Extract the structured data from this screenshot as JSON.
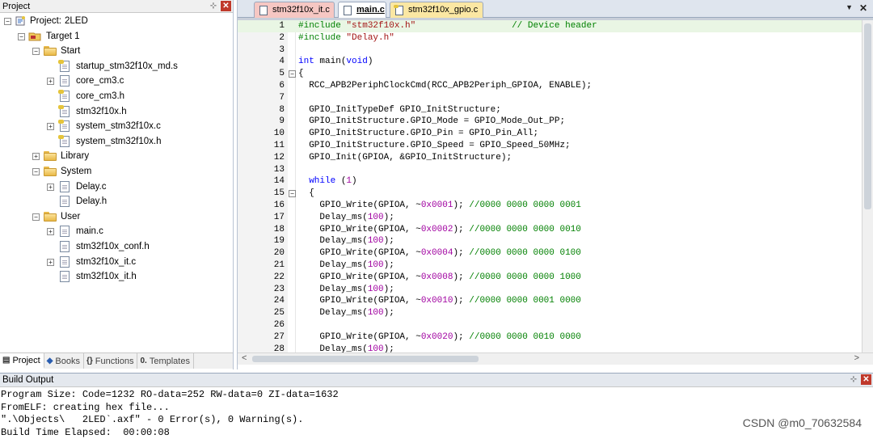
{
  "project_panel": {
    "title": "Project",
    "pin": "⊹",
    "close": "✕",
    "tree": {
      "project_label": "Project:",
      "project_name": "2LED",
      "target": "Target 1",
      "groups": [
        {
          "name": "Start",
          "files": [
            "startup_stm32f10x_md.s",
            "core_cm3.c",
            "core_cm3.h",
            "stm32f10x.h",
            "system_stm32f10x.c",
            "system_stm32f10x.h"
          ]
        },
        {
          "name": "Library",
          "files": []
        },
        {
          "name": "System",
          "files": [
            "Delay.c",
            "Delay.h"
          ]
        },
        {
          "name": "User",
          "files": [
            "main.c",
            "stm32f10x_conf.h",
            "stm32f10x_it.c",
            "stm32f10x_it.h"
          ]
        }
      ]
    },
    "tabs": [
      "Project",
      "Books",
      "Functions",
      "Templates"
    ]
  },
  "editor": {
    "tabs": [
      "stm32f10x_it.c",
      "main.c",
      "stm32f10x_gpio.c"
    ],
    "active_tab": "main.c",
    "lines": [
      "#include \"stm32f10x.h\"                  // Device header",
      "#include \"Delay.h\"",
      "",
      "int main(void)",
      "{",
      "  RCC_APB2PeriphClockCmd(RCC_APB2Periph_GPIOA, ENABLE);",
      "",
      "  GPIO_InitTypeDef GPIO_InitStructure;",
      "  GPIO_InitStructure.GPIO_Mode = GPIO_Mode_Out_PP;",
      "  GPIO_InitStructure.GPIO_Pin = GPIO_Pin_All;",
      "  GPIO_InitStructure.GPIO_Speed = GPIO_Speed_50MHz;",
      "  GPIO_Init(GPIOA, &GPIO_InitStructure);",
      "",
      "  while (1)",
      "  {",
      "    GPIO_Write(GPIOA, ~0x0001); //0000 0000 0000 0001",
      "    Delay_ms(100);",
      "    GPIO_Write(GPIOA, ~0x0002); //0000 0000 0000 0010",
      "    Delay_ms(100);",
      "    GPIO_Write(GPIOA, ~0x0004); //0000 0000 0000 0100",
      "    Delay_ms(100);",
      "    GPIO_Write(GPIOA, ~0x0008); //0000 0000 0000 1000",
      "    Delay_ms(100);",
      "    GPIO_Write(GPIOA, ~0x0010); //0000 0000 0001 0000",
      "    Delay_ms(100);",
      "",
      "    GPIO_Write(GPIOA, ~0x0020); //0000 0000 0010 0000",
      "    Delay_ms(100);"
    ],
    "fold_lines": [
      5,
      15
    ],
    "highlight_line": 1,
    "vscroll_up": "▲",
    "vscroll_down": "▼",
    "hscroll_left": "<",
    "hscroll_right": ">"
  },
  "build_output": {
    "title": "Build Output",
    "pin": "⊹",
    "close": "✕",
    "lines": [
      "Program Size: Code=1232 RO-data=252 RW-data=0 ZI-data=1632",
      "FromELF: creating hex file...",
      "\".\\Objects\\   2LED`.axf\" - 0 Error(s), 0 Warning(s).",
      "Build Time Elapsed:  00:00:08"
    ]
  },
  "watermark": "CSDN @m0_70632584",
  "colors": {
    "keyword": "#0000ff",
    "preprocessor": "#008000",
    "comment": "#008000",
    "number": "#a000a0",
    "highlight": "#e9f6e4",
    "tab_it": "#f6c7c3",
    "tab_gpio": "#fbe7a3"
  }
}
